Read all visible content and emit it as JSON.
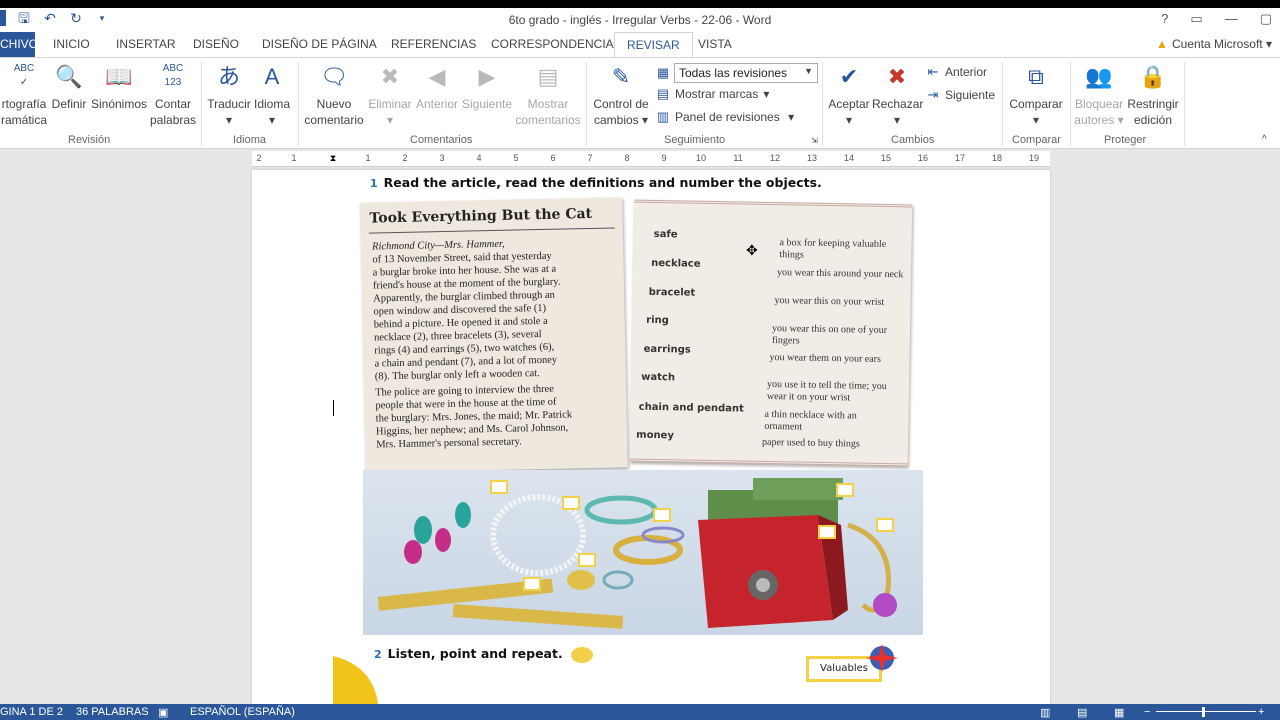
{
  "window": {
    "title": "6to grado - inglés - Irregular Verbs - 22-06 - Word",
    "controls": [
      "?",
      "▭",
      "—",
      "▢"
    ]
  },
  "quick_access": [
    "save-icon",
    "undo-icon",
    "redo-icon",
    "customize-icon"
  ],
  "tabs": [
    "CHIVO",
    "INICIO",
    "INSERTAR",
    "DISEÑO",
    "DISEÑO DE PÁGINA",
    "REFERENCIAS",
    "CORRESPONDENCIA",
    "REVISAR",
    "VISTA"
  ],
  "active_tab": "REVISAR",
  "account": "Cuenta Microsoft",
  "ribbon": {
    "revision": {
      "label": "Revisión",
      "ortografia": "rtografía",
      "ortografia2": "ramática",
      "definir": "Definir",
      "sinonimos": "Sinónimos",
      "contar1": "Contar",
      "contar2": "palabras",
      "abc": "ABC",
      "abc123": "ABC 123"
    },
    "idioma": {
      "label": "Idioma",
      "traducir": "Traducir",
      "idioma": "Idioma"
    },
    "comentarios": {
      "label": "Comentarios",
      "nuevo1": "Nuevo",
      "nuevo2": "comentario",
      "eliminar": "Eliminar",
      "anterior": "Anterior",
      "siguiente": "Siguiente",
      "mostrar1": "Mostrar",
      "mostrar2": "comentarios"
    },
    "seguimiento": {
      "label": "Seguimiento",
      "control1": "Control de",
      "control2": "cambios",
      "dropdown_value": "Todas las revisiones",
      "mostrar_marcas": "Mostrar marcas",
      "panel": "Panel de revisiones"
    },
    "cambios": {
      "label": "Cambios",
      "aceptar": "Aceptar",
      "rechazar": "Rechazar",
      "anterior": "Anterior",
      "siguiente": "Siguiente"
    },
    "comparar": {
      "label": "Comparar",
      "comparar": "Comparar"
    },
    "proteger": {
      "label": "Proteger",
      "bloquear1": "Bloquear",
      "bloquear2": "autores",
      "restringir1": "Restringir",
      "restringir2": "edición"
    }
  },
  "ruler_ticks": [
    "2",
    "1",
    "1",
    "2",
    "3",
    "4",
    "5",
    "6",
    "7",
    "8",
    "9",
    "10",
    "11",
    "12",
    "13",
    "14",
    "15",
    "16",
    "17",
    "18",
    "19"
  ],
  "document": {
    "instruction1_num": "1",
    "instruction1": "Read the article, read the definitions and number the objects.",
    "article_title": "Took Everything But the Cat",
    "article_lines": [
      "Richmond City—Mrs. Hammer,",
      "of 13 November Street, said that yesterday",
      "a burglar broke into her house. She was at a",
      "friend's house at the moment of the burglary.",
      "Apparently, the burglar climbed through an",
      "open window and discovered the safe (1)",
      "behind a picture. He opened it and stole a",
      "necklace (2), three bracelets (3), several",
      "rings (4) and earrings (5), two watches (6),",
      "a chain and pendant (7), and a lot of money",
      "(8). The burglar only left a wooden cat.",
      "The police are going to interview the three",
      "people that were in the house at the time of",
      "the burglary: Mrs. Jones, the maid; Mr. Patrick",
      "Higgins, her nephew; and Ms. Carol Johnson,",
      "Mrs. Hammer's personal secretary."
    ],
    "words": [
      "safe",
      "necklace",
      "bracelet",
      "ring",
      "earrings",
      "watch",
      "chain and pendant",
      "money"
    ],
    "definitions": [
      "a box for keeping valuable things",
      "you wear this around your neck",
      "you wear this on your wrist",
      "you wear this on one of your fingers",
      "you wear them on your ears",
      "you use it to tell the time; you wear it on your wrist",
      "a thin necklace with an ornament",
      "paper used to buy things"
    ],
    "instruction2_num": "2",
    "instruction2": "Listen, point and repeat.",
    "badge": "Valuables"
  },
  "status": {
    "page": "GINA 1 DE 2",
    "words": "36 PALABRAS",
    "language": "ESPAÑOL (ESPAÑA)",
    "zoom_ctrl": "−   +"
  }
}
